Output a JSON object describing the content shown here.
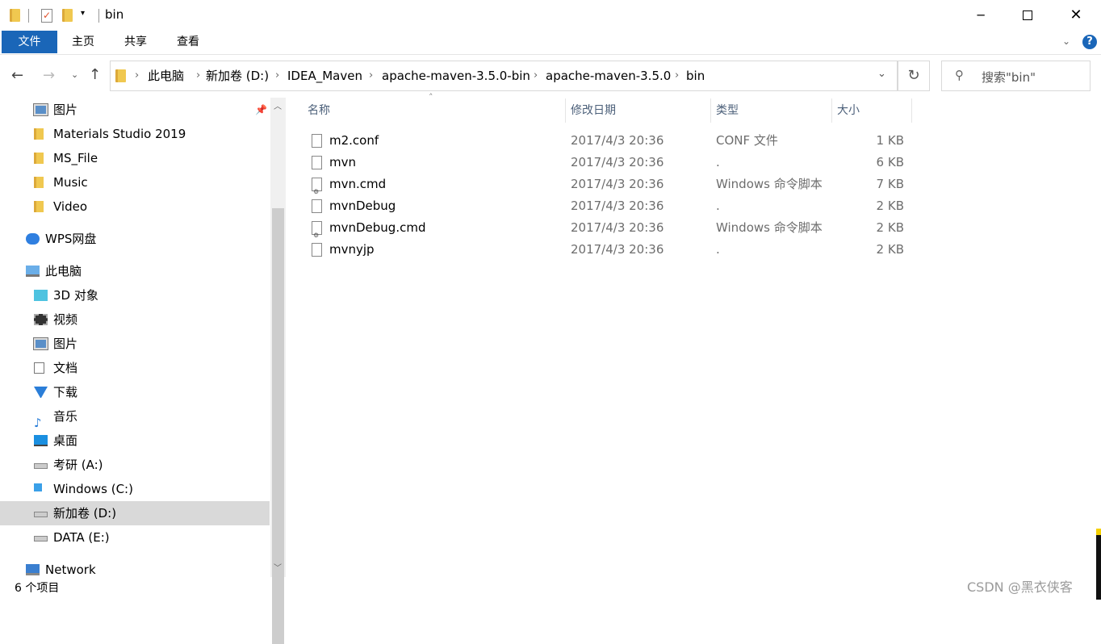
{
  "window": {
    "title": "bin",
    "controls": [
      "minimize",
      "maximize",
      "close"
    ]
  },
  "ribbon": {
    "tabs": [
      "文件",
      "主页",
      "共享",
      "查看"
    ],
    "accent": "#1a66b8"
  },
  "address": {
    "crumbs": [
      "此电脑",
      "新加卷 (D:)",
      "IDEA_Maven",
      "apache-maven-3.5.0-bin",
      "apache-maven-3.5.0",
      "bin"
    ],
    "search_placeholder": "搜索\"bin\""
  },
  "nav": {
    "items": [
      {
        "label": "图片",
        "icon": "pictures-icon",
        "pinned": true
      },
      {
        "label": "Materials Studio 2019",
        "icon": "folder-icon"
      },
      {
        "label": "MS_File",
        "icon": "folder-icon"
      },
      {
        "label": "Music",
        "icon": "folder-icon"
      },
      {
        "label": "Video",
        "icon": "folder-icon"
      },
      {
        "label": "WPS网盘",
        "icon": "cloud-icon",
        "top": true
      },
      {
        "label": "此电脑",
        "icon": "computer-icon",
        "top": true
      },
      {
        "label": "3D 对象",
        "icon": "cube-icon"
      },
      {
        "label": "视频",
        "icon": "video-icon"
      },
      {
        "label": "图片",
        "icon": "pictures-icon"
      },
      {
        "label": "文档",
        "icon": "document-icon"
      },
      {
        "label": "下载",
        "icon": "download-icon"
      },
      {
        "label": "音乐",
        "icon": "music-icon"
      },
      {
        "label": "桌面",
        "icon": "desktop-icon"
      },
      {
        "label": "考研 (A:)",
        "icon": "drive-icon"
      },
      {
        "label": "Windows (C:)",
        "icon": "windows-drive-icon"
      },
      {
        "label": "新加卷 (D:)",
        "icon": "drive-icon",
        "selected": true
      },
      {
        "label": "DATA (E:)",
        "icon": "drive-icon"
      },
      {
        "label": "Network",
        "icon": "network-icon",
        "top": true
      }
    ]
  },
  "columns": [
    "名称",
    "修改日期",
    "类型",
    "大小"
  ],
  "files": [
    {
      "name": "m2.conf",
      "date": "2017/4/3 20:36",
      "type": "CONF 文件",
      "size": "1 KB",
      "icon": "file-icon"
    },
    {
      "name": "mvn",
      "date": "2017/4/3 20:36",
      "type": ".",
      "size": "6 KB",
      "icon": "file-icon"
    },
    {
      "name": "mvn.cmd",
      "date": "2017/4/3 20:36",
      "type": "Windows 命令脚本",
      "size": "7 KB",
      "icon": "script-icon"
    },
    {
      "name": "mvnDebug",
      "date": "2017/4/3 20:36",
      "type": ".",
      "size": "2 KB",
      "icon": "file-icon"
    },
    {
      "name": "mvnDebug.cmd",
      "date": "2017/4/3 20:36",
      "type": "Windows 命令脚本",
      "size": "2 KB",
      "icon": "script-icon"
    },
    {
      "name": "mvnyjp",
      "date": "2017/4/3 20:36",
      "type": ".",
      "size": "2 KB",
      "icon": "file-icon"
    }
  ],
  "status": {
    "count": "6 个项目"
  },
  "watermark": "CSDN @黑衣侠客"
}
